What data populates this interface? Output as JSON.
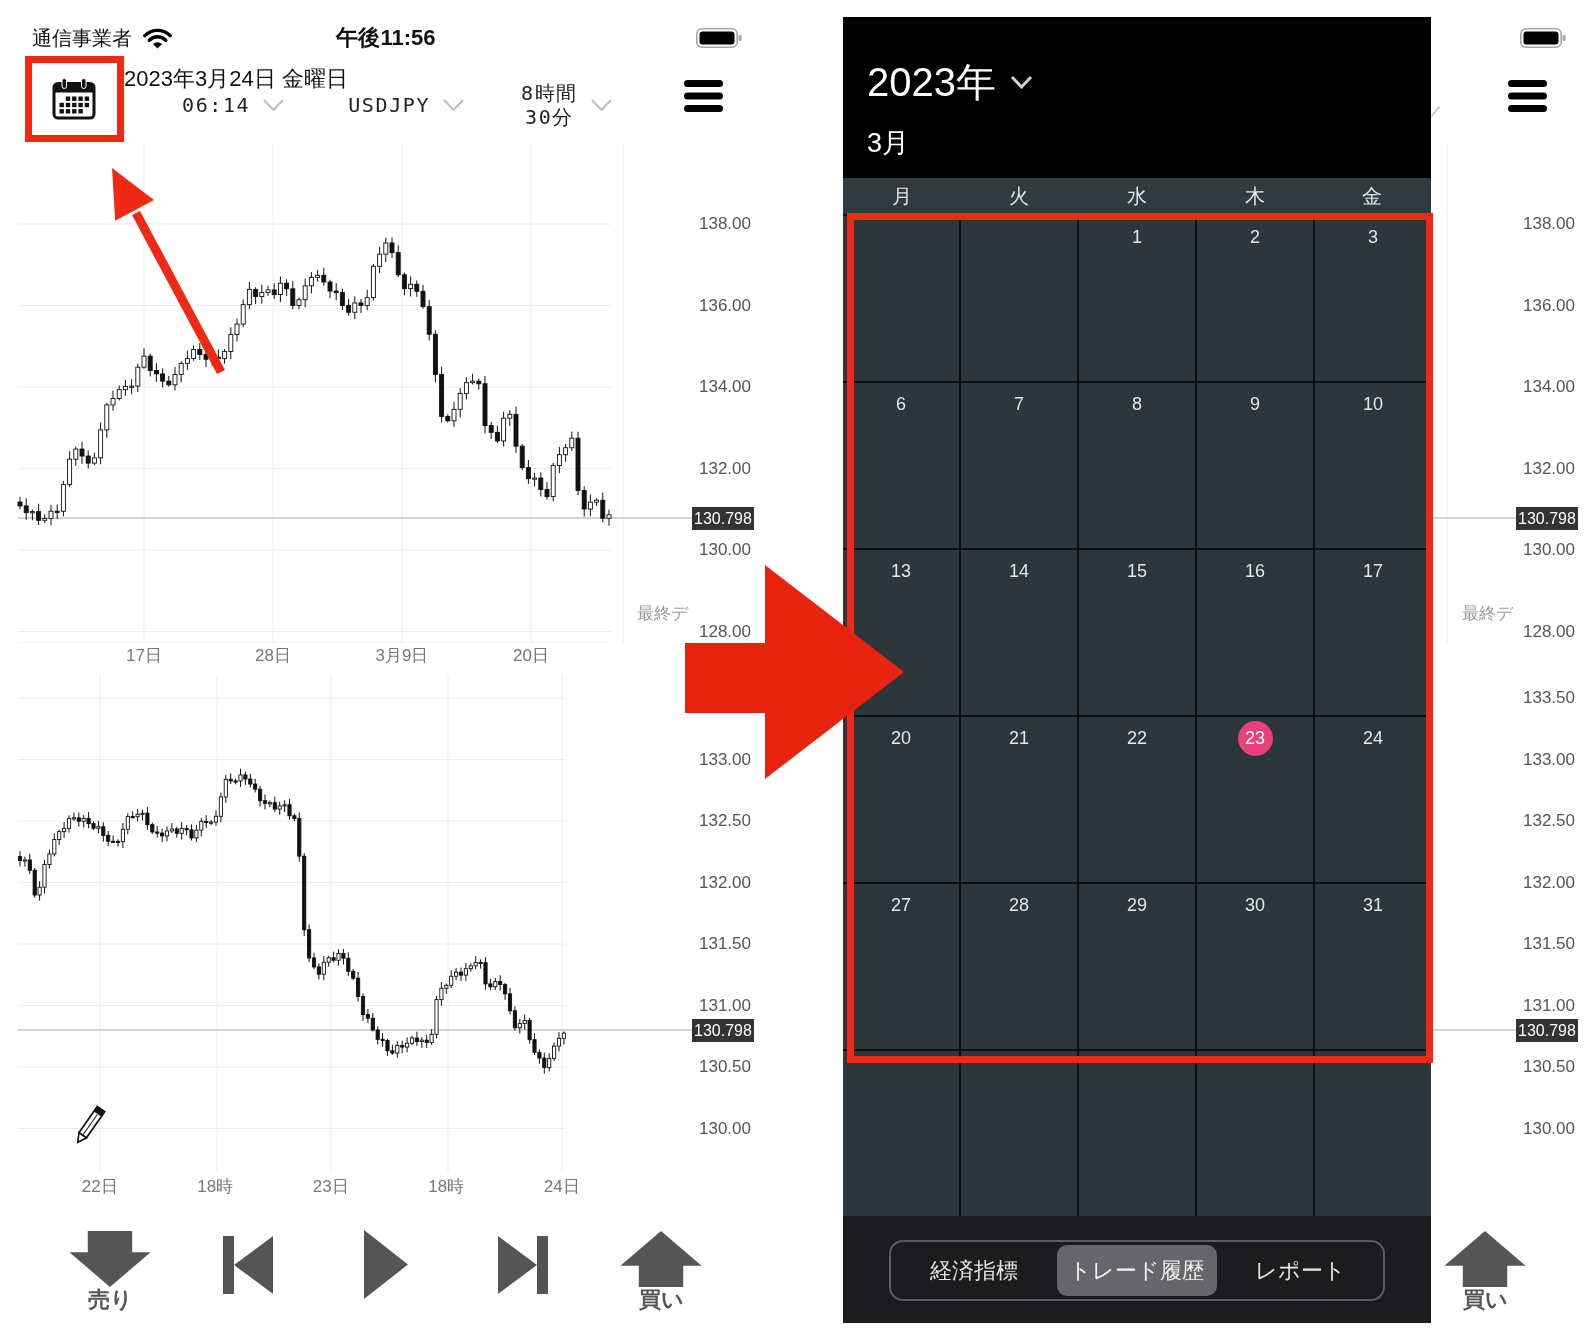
{
  "left_screen": {
    "status_bar": {
      "carrier": "通信事業者",
      "clock": "午後11:56"
    },
    "header": {
      "date": "2023年3月24日 金曜日",
      "dropdowns": [
        {
          "lines": [
            "06:14"
          ]
        },
        {
          "lines": [
            "USDJPY"
          ]
        },
        {
          "lines": [
            "8時間",
            "30分"
          ]
        }
      ]
    },
    "upper_chart": {
      "y_labels": [
        "138.00",
        "136.00",
        "134.00",
        "132.00",
        "130.00",
        "128.00"
      ],
      "price_tag": "130.798",
      "note": "最終デ",
      "x_labels": [
        "17日",
        "28日",
        "3月9日",
        "20日"
      ]
    },
    "lower_chart": {
      "y_labels": [
        "133.00",
        "132.50",
        "132.00",
        "131.50",
        "131.00",
        "130.50",
        "130.00"
      ],
      "price_tag": "130.798",
      "x_labels": [
        "22日",
        "18時",
        "23日",
        "18時",
        "24日"
      ]
    },
    "toolbar": [
      {
        "kind": "sell",
        "label": "売り"
      },
      {
        "kind": "first"
      },
      {
        "kind": "play"
      },
      {
        "kind": "last"
      },
      {
        "kind": "buy",
        "label": "買い"
      }
    ]
  },
  "right_screen": {
    "calendar": {
      "year": "2023年",
      "month": "3月",
      "weekdays": [
        "月",
        "火",
        "水",
        "木",
        "金"
      ],
      "weeks": [
        {
          "days": [
            {
              "kind": "blank"
            },
            {
              "kind": "blank"
            },
            {
              "kind": "day",
              "label": "1",
              "today": false
            },
            {
              "kind": "day",
              "label": "2",
              "today": false
            },
            {
              "kind": "day",
              "label": "3",
              "today": false
            }
          ]
        },
        {
          "days": [
            {
              "kind": "day",
              "label": "6",
              "today": false
            },
            {
              "kind": "day",
              "label": "7",
              "today": false
            },
            {
              "kind": "day",
              "label": "8",
              "today": false
            },
            {
              "kind": "day",
              "label": "9",
              "today": false
            },
            {
              "kind": "day",
              "label": "10",
              "today": false
            }
          ]
        },
        {
          "days": [
            {
              "kind": "day",
              "label": "13",
              "today": false
            },
            {
              "kind": "day",
              "label": "14",
              "today": false
            },
            {
              "kind": "day",
              "label": "15",
              "today": false
            },
            {
              "kind": "day",
              "label": "16",
              "today": false
            },
            {
              "kind": "day",
              "label": "17",
              "today": false
            }
          ]
        },
        {
          "days": [
            {
              "kind": "day",
              "label": "20",
              "today": false
            },
            {
              "kind": "day",
              "label": "21",
              "today": false
            },
            {
              "kind": "day",
              "label": "22",
              "today": false
            },
            {
              "kind": "day",
              "label": "23",
              "today": true
            },
            {
              "kind": "day",
              "label": "24",
              "today": false
            }
          ]
        },
        {
          "days": [
            {
              "kind": "day",
              "label": "27",
              "today": false
            },
            {
              "kind": "day",
              "label": "28",
              "today": false
            },
            {
              "kind": "day",
              "label": "29",
              "today": false
            },
            {
              "kind": "day",
              "label": "30",
              "today": false
            },
            {
              "kind": "day",
              "label": "31",
              "today": false
            }
          ]
        },
        {
          "days": [
            {
              "kind": "blank"
            },
            {
              "kind": "blank"
            },
            {
              "kind": "blank"
            },
            {
              "kind": "blank"
            },
            {
              "kind": "blank"
            }
          ]
        }
      ],
      "tabs": [
        {
          "label": "経済指標",
          "selected": false
        },
        {
          "label": "トレード履歴",
          "selected": true
        },
        {
          "label": "レポート",
          "selected": false
        }
      ]
    },
    "upper_axis": {
      "y_labels": [
        "138.00",
        "136.00",
        "134.00",
        "132.00",
        "130.00",
        "128.00"
      ],
      "price_tag": "130.798",
      "note": "最終デ"
    },
    "lower_axis": {
      "y_labels": [
        "133.50",
        "133.00",
        "132.50",
        "132.00",
        "131.50",
        "131.00",
        "130.50",
        "130.00"
      ],
      "price_tag": "130.798"
    },
    "toolbar": [
      {
        "kind": "buy",
        "label": "買い"
      }
    ]
  }
}
